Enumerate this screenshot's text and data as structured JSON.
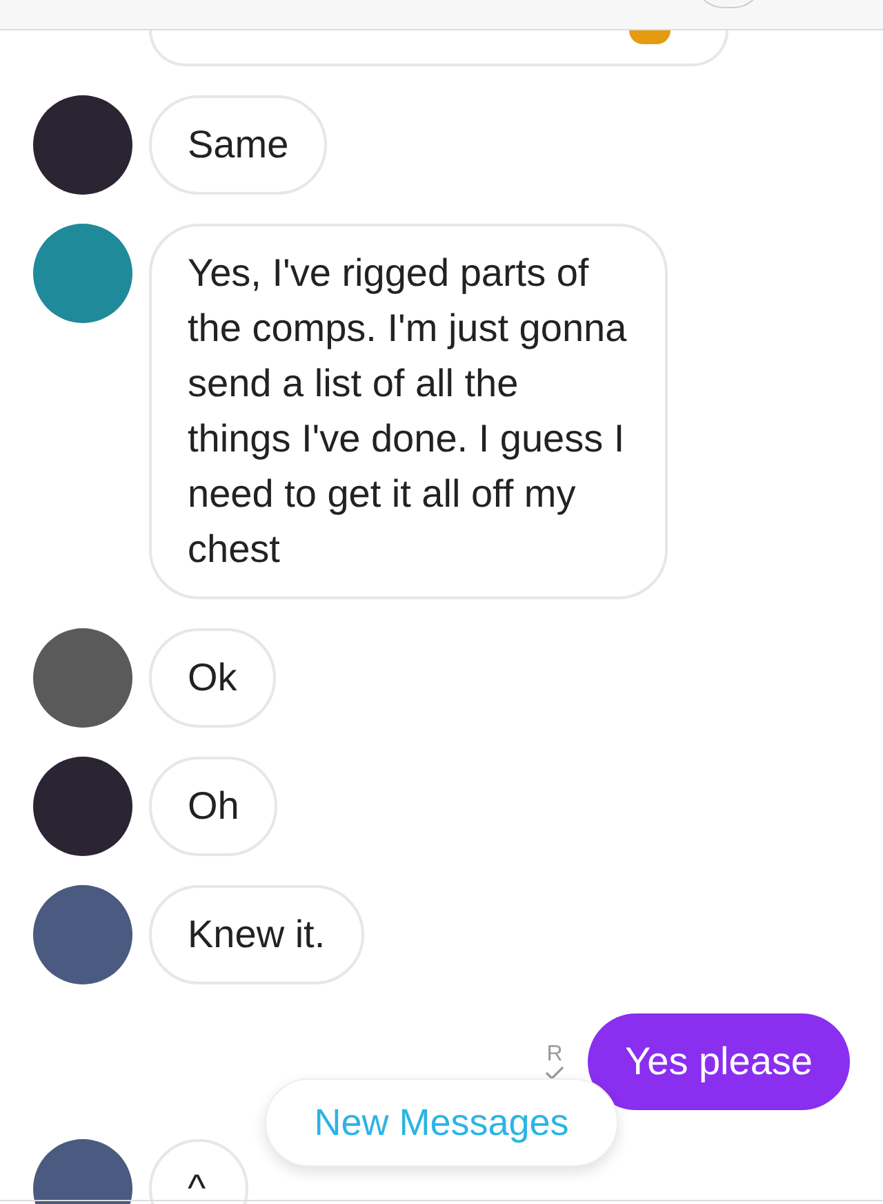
{
  "messages": [
    {
      "kind": "incoming",
      "color": "#2a2433",
      "text": "Same"
    },
    {
      "kind": "incoming",
      "color": "#1f8a9a",
      "text": "Yes, I've rigged parts of the comps. I'm just gonna send a list of all the things I've done. I guess I need to get it all off my chest"
    },
    {
      "kind": "incoming",
      "color": "#5a5a5a",
      "text": "Ok"
    },
    {
      "kind": "incoming",
      "color": "#2a2433",
      "text": "Oh"
    },
    {
      "kind": "incoming",
      "color": "#4a5a80",
      "text": "Knew it."
    },
    {
      "kind": "outgoing",
      "read_receipt": "R",
      "text": "Yes please"
    },
    {
      "kind": "incoming",
      "color": "#4a5a80",
      "text": "^"
    }
  ],
  "new_messages_button": "New Messages"
}
